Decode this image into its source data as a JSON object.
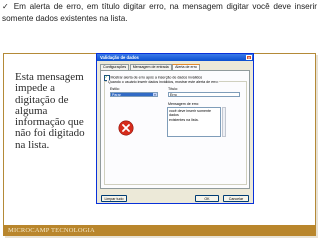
{
  "slide": {
    "check_mark": "✓",
    "instruction": "Em alerta de erro, em título digitar erro, na mensagem digitar você deve inserir somente dados existentes na lista.",
    "side_note": "Esta mensagem\nimpede a\ndigitação de\nalguma\ninformação que\nnão foi digitado\nna lista.",
    "footer": "MICROCAMP TECNOLOGIA",
    "accent_color": "#b9862c"
  },
  "dialog": {
    "title": "Validação de dados",
    "close_icon": "close-icon",
    "tabs": [
      {
        "label": "Configurações"
      },
      {
        "label": "Mensagem de entrada"
      },
      {
        "label": "Alerta de erro"
      }
    ],
    "show_alert_checkbox": {
      "label": "Mostrar alerta de erro após a inserção de dados inválidos",
      "checked": true
    },
    "group_title": "Quando o usuário inserir dados inválidos, mostrar este alerta de erro:",
    "style": {
      "label": "Estilo:",
      "value": "Parar"
    },
    "title_field": {
      "label": "Título:",
      "value": "Erro"
    },
    "message": {
      "label": "Mensagem de erro:",
      "value": "você deve inserir somente dados\nexistentes na lista."
    },
    "error_icon": "error-stop-icon",
    "buttons": {
      "clear_all": "Limpar tudo",
      "ok": "OK",
      "cancel": "Cancelar"
    }
  }
}
